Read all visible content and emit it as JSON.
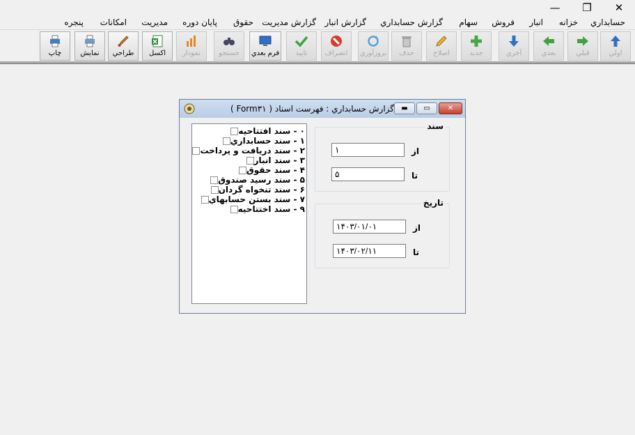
{
  "window_controls": {
    "minimize": "—",
    "restore": "❐",
    "close": "✕"
  },
  "menu": [
    "حسابداري",
    "خزانه",
    "انبار",
    "فروش",
    "سهام",
    "گزارش حسابداري",
    "گزارش انبار",
    "گزارش مديريت",
    "حقوق",
    "پايان دوره",
    "مديريت",
    "امكانات",
    "پنجره"
  ],
  "toolbar": {
    "first": "اولي",
    "prev": "قبلي",
    "next": "بعدي",
    "last": "آخري",
    "new": "جديد",
    "edit": "اصلاح",
    "delete": "حذف",
    "refresh": "بروزآوري",
    "cancel": "انصراف",
    "confirm": "تاييد",
    "next_form": "فرم بعدي",
    "search": "جستجو",
    "chart": "نمودار",
    "excel": "اكسل",
    "design": "طراحي",
    "preview": "نمايش",
    "print": "چاپ"
  },
  "dialog": {
    "title": "گزارش حسابداري : فهرست اسناد ( Form۳۱ )",
    "doc_types": [
      "۰ - سند افتتاحيه",
      "۱ - سند حسابداري",
      "۲ - سند دريافت و پرداخت",
      "۳ - سند انبار",
      "۴ - سند حقوق",
      "۵ - سند رسيد صندوق",
      "۶ - سند تنخواه گردان",
      "۷ - سند بستن حسابهاي",
      "۹ - سند اختتاحيه"
    ],
    "doc_group": {
      "title": "سند",
      "from_label": "از",
      "from_value": "۱",
      "to_label": "تا",
      "to_value": "۵"
    },
    "date_group": {
      "title": "تاريخ",
      "from_label": "از",
      "from_value": "۱۴۰۳/۰۱/۰۱",
      "to_label": "تا",
      "to_value": "۱۴۰۳/۰۲/۱۱"
    }
  }
}
